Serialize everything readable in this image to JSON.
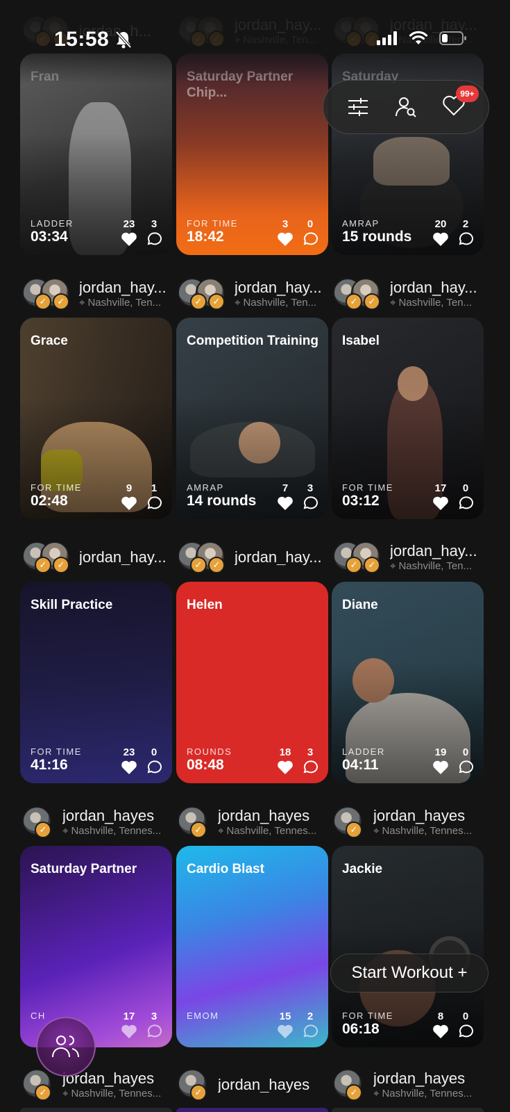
{
  "status": {
    "time": "15:58"
  },
  "toolbar": {
    "notif_count": "99+"
  },
  "start_button": "Start Workout +",
  "rows": [
    {
      "users": [
        {
          "name": "jordan_h...",
          "location": ""
        },
        {
          "name": "jordan_hay...",
          "location": "Nashville, Ten..."
        },
        {
          "name": "jordan_hay...",
          "location": "Nashville, Ten..."
        }
      ],
      "cards": [
        {
          "title": "Fran",
          "type": "LADDER",
          "value": "03:34",
          "likes": "23",
          "comments": "3"
        },
        {
          "title": "Saturday Partner Chip...",
          "type": "FOR TIME",
          "value": "18:42",
          "likes": "3",
          "comments": "0"
        },
        {
          "title": "Saturday",
          "type": "AMRAP",
          "value": "15 rounds",
          "likes": "20",
          "comments": "2"
        }
      ]
    },
    {
      "users": [
        {
          "name": "jordan_hay...",
          "location": "Nashville, Ten..."
        },
        {
          "name": "jordan_hay...",
          "location": "Nashville, Ten..."
        },
        {
          "name": "jordan_hay...",
          "location": "Nashville, Ten..."
        }
      ],
      "cards": [
        {
          "title": "Grace",
          "type": "FOR TIME",
          "value": "02:48",
          "likes": "9",
          "comments": "1"
        },
        {
          "title": "Competition Training",
          "type": "AMRAP",
          "value": "14 rounds",
          "likes": "7",
          "comments": "3"
        },
        {
          "title": "Isabel",
          "type": "FOR TIME",
          "value": "03:12",
          "likes": "17",
          "comments": "0"
        }
      ]
    },
    {
      "users": [
        {
          "name": "jordan_hay...",
          "location": ""
        },
        {
          "name": "jordan_hay...",
          "location": ""
        },
        {
          "name": "jordan_hay...",
          "location": "Nashville, Ten..."
        }
      ],
      "cards": [
        {
          "title": "Skill Practice",
          "type": "FOR TIME",
          "value": "41:16",
          "likes": "23",
          "comments": "0"
        },
        {
          "title": "Helen",
          "type": "ROUNDS",
          "value": "08:48",
          "likes": "18",
          "comments": "3"
        },
        {
          "title": "Diane",
          "type": "LADDER",
          "value": "04:11",
          "likes": "19",
          "comments": "0"
        }
      ]
    },
    {
      "users": [
        {
          "name": "jordan_hayes",
          "location": "Nashville, Tennes..."
        },
        {
          "name": "jordan_hayes",
          "location": "Nashville, Tennes..."
        },
        {
          "name": "jordan_hayes",
          "location": "Nashville, Tennes..."
        }
      ],
      "cards": [
        {
          "title": "Saturday Partner",
          "type": "CH",
          "value": "",
          "likes": "17",
          "comments": "3"
        },
        {
          "title": "Cardio Blast",
          "type": "EMOM",
          "value": "",
          "likes": "15",
          "comments": "2"
        },
        {
          "title": "Jackie",
          "type": "FOR TIME",
          "value": "06:18",
          "likes": "8",
          "comments": "0"
        }
      ]
    },
    {
      "users": [
        {
          "name": "jordan_hayes",
          "location": "Nashville, Tennes..."
        },
        {
          "name": "jordan_hayes",
          "location": ""
        },
        {
          "name": "jordan_hayes",
          "location": "Nashville, Tennes..."
        }
      ],
      "cards": []
    }
  ]
}
